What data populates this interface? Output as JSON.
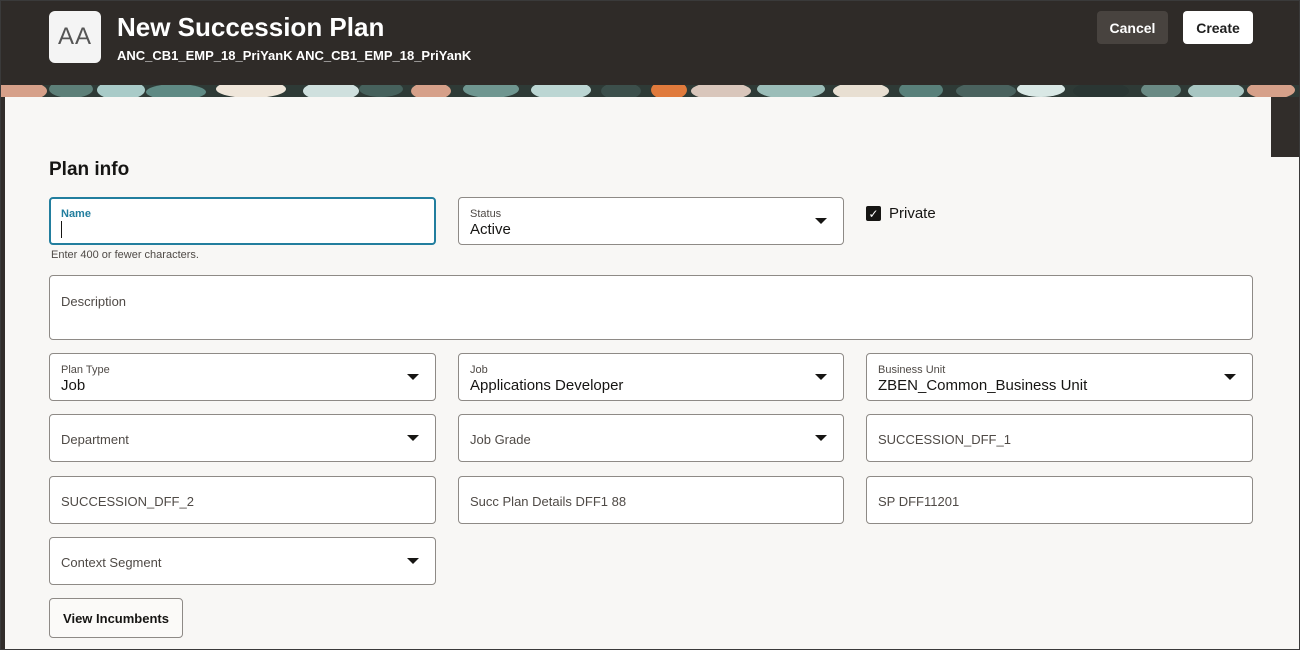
{
  "header": {
    "avatar_initials": "AA",
    "title": "New Succession Plan",
    "subtitle": "ANC_CB1_EMP_18_PriYanK ANC_CB1_EMP_18_PriYanK",
    "cancel_label": "Cancel",
    "create_label": "Create"
  },
  "plan_info": {
    "section_title": "Plan info",
    "name": {
      "label": "Name",
      "value": "",
      "helper": "Enter 400 or fewer characters."
    },
    "status": {
      "label": "Status",
      "value": "Active"
    },
    "private": {
      "label": "Private",
      "checked": true
    },
    "description": {
      "placeholder": "Description"
    },
    "plan_type": {
      "label": "Plan Type",
      "value": "Job"
    },
    "job": {
      "label": "Job",
      "value": "Applications Developer"
    },
    "business_unit": {
      "label": "Business Unit",
      "value": "ZBEN_Common_Business Unit"
    },
    "department": {
      "placeholder": "Department"
    },
    "job_grade": {
      "placeholder": "Job Grade"
    },
    "succession_dff_1": {
      "placeholder": "SUCCESSION_DFF_1"
    },
    "succession_dff_2": {
      "placeholder": "SUCCESSION_DFF_2"
    },
    "succ_plan_details": {
      "placeholder": "Succ Plan Details DFF1 88"
    },
    "sp_dff": {
      "placeholder": "SP DFF11201"
    },
    "context_segment": {
      "placeholder": "Context Segment"
    },
    "view_incumbents_label": "View Incumbents"
  },
  "colors": {
    "header_bg": "#2f2b28",
    "content_bg": "#f8f7f5",
    "focus_accent": "#227e9e"
  }
}
